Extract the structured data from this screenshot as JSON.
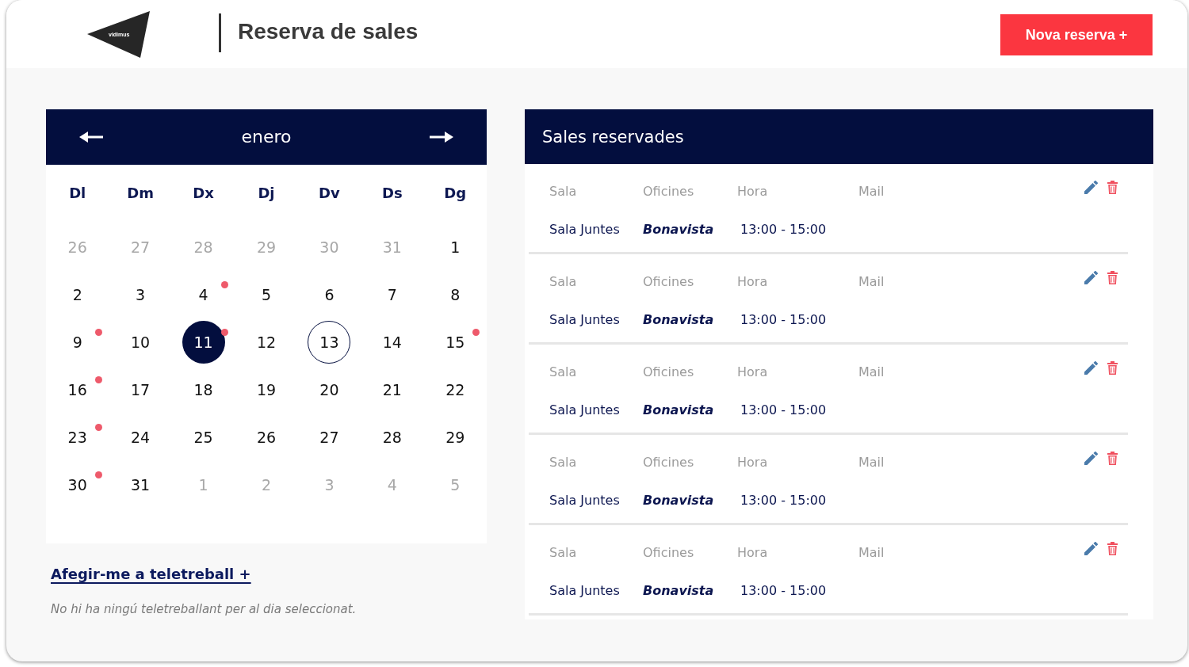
{
  "header": {
    "logo_text": "vidimus",
    "title": "Reserva de sales",
    "new_button": "Nova reserva +"
  },
  "calendar": {
    "month": "enero",
    "weekdays": [
      "Dl",
      "Dm",
      "Dx",
      "Dj",
      "Dv",
      "Ds",
      "Dg"
    ],
    "days": [
      {
        "label": "26",
        "outside_month": true,
        "selected": false,
        "today": false,
        "marked": false
      },
      {
        "label": "27",
        "outside_month": true,
        "selected": false,
        "today": false,
        "marked": false
      },
      {
        "label": "28",
        "outside_month": true,
        "selected": false,
        "today": false,
        "marked": false
      },
      {
        "label": "29",
        "outside_month": true,
        "selected": false,
        "today": false,
        "marked": false
      },
      {
        "label": "30",
        "outside_month": true,
        "selected": false,
        "today": false,
        "marked": false
      },
      {
        "label": "31",
        "outside_month": true,
        "selected": false,
        "today": false,
        "marked": false
      },
      {
        "label": "1",
        "outside_month": false,
        "selected": false,
        "today": false,
        "marked": false
      },
      {
        "label": "2",
        "outside_month": false,
        "selected": false,
        "today": false,
        "marked": false
      },
      {
        "label": "3",
        "outside_month": false,
        "selected": false,
        "today": false,
        "marked": false
      },
      {
        "label": "4",
        "outside_month": false,
        "selected": false,
        "today": false,
        "marked": true
      },
      {
        "label": "5",
        "outside_month": false,
        "selected": false,
        "today": false,
        "marked": false
      },
      {
        "label": "6",
        "outside_month": false,
        "selected": false,
        "today": false,
        "marked": false
      },
      {
        "label": "7",
        "outside_month": false,
        "selected": false,
        "today": false,
        "marked": false
      },
      {
        "label": "8",
        "outside_month": false,
        "selected": false,
        "today": false,
        "marked": false
      },
      {
        "label": "9",
        "outside_month": false,
        "selected": false,
        "today": false,
        "marked": true
      },
      {
        "label": "10",
        "outside_month": false,
        "selected": false,
        "today": false,
        "marked": false
      },
      {
        "label": "11",
        "outside_month": false,
        "selected": true,
        "today": false,
        "marked": true
      },
      {
        "label": "12",
        "outside_month": false,
        "selected": false,
        "today": false,
        "marked": false
      },
      {
        "label": "13",
        "outside_month": false,
        "selected": false,
        "today": true,
        "marked": false
      },
      {
        "label": "14",
        "outside_month": false,
        "selected": false,
        "today": false,
        "marked": false
      },
      {
        "label": "15",
        "outside_month": false,
        "selected": false,
        "today": false,
        "marked": true
      },
      {
        "label": "16",
        "outside_month": false,
        "selected": false,
        "today": false,
        "marked": true
      },
      {
        "label": "17",
        "outside_month": false,
        "selected": false,
        "today": false,
        "marked": false
      },
      {
        "label": "18",
        "outside_month": false,
        "selected": false,
        "today": false,
        "marked": false
      },
      {
        "label": "19",
        "outside_month": false,
        "selected": false,
        "today": false,
        "marked": false
      },
      {
        "label": "20",
        "outside_month": false,
        "selected": false,
        "today": false,
        "marked": false
      },
      {
        "label": "21",
        "outside_month": false,
        "selected": false,
        "today": false,
        "marked": false
      },
      {
        "label": "22",
        "outside_month": false,
        "selected": false,
        "today": false,
        "marked": false
      },
      {
        "label": "23",
        "outside_month": false,
        "selected": false,
        "today": false,
        "marked": true
      },
      {
        "label": "24",
        "outside_month": false,
        "selected": false,
        "today": false,
        "marked": false
      },
      {
        "label": "25",
        "outside_month": false,
        "selected": false,
        "today": false,
        "marked": false
      },
      {
        "label": "26",
        "outside_month": false,
        "selected": false,
        "today": false,
        "marked": false
      },
      {
        "label": "27",
        "outside_month": false,
        "selected": false,
        "today": false,
        "marked": false
      },
      {
        "label": "28",
        "outside_month": false,
        "selected": false,
        "today": false,
        "marked": false
      },
      {
        "label": "29",
        "outside_month": false,
        "selected": false,
        "today": false,
        "marked": false
      },
      {
        "label": "30",
        "outside_month": false,
        "selected": false,
        "today": false,
        "marked": true
      },
      {
        "label": "31",
        "outside_month": false,
        "selected": false,
        "today": false,
        "marked": false
      },
      {
        "label": "1",
        "outside_month": true,
        "selected": false,
        "today": false,
        "marked": false
      },
      {
        "label": "2",
        "outside_month": true,
        "selected": false,
        "today": false,
        "marked": false
      },
      {
        "label": "3",
        "outside_month": true,
        "selected": false,
        "today": false,
        "marked": false
      },
      {
        "label": "4",
        "outside_month": true,
        "selected": false,
        "today": false,
        "marked": false
      },
      {
        "label": "5",
        "outside_month": true,
        "selected": false,
        "today": false,
        "marked": false
      }
    ]
  },
  "telework": {
    "link": "Afegir-me a teletreball +",
    "message": "No hi ha ningú teletreballant per al dia seleccionat."
  },
  "reservations": {
    "title": "Sales reservades",
    "items": [
      {
        "fields": [
          {
            "label": "Sala",
            "value": "Sala Juntes"
          },
          {
            "label": "Oficines",
            "value": "Bonavista"
          },
          {
            "label": "Hora",
            "value": "13:00 - 15:00"
          },
          {
            "label": "Mail"
          }
        ]
      },
      {
        "fields": [
          {
            "label": "Sala",
            "value": "Sala Juntes"
          },
          {
            "label": "Oficines",
            "value": "Bonavista"
          },
          {
            "label": "Hora",
            "value": "13:00 - 15:00"
          },
          {
            "label": "Mail"
          }
        ]
      },
      {
        "fields": [
          {
            "label": "Sala",
            "value": "Sala Juntes"
          },
          {
            "label": "Oficines",
            "value": "Bonavista"
          },
          {
            "label": "Hora",
            "value": "13:00 - 15:00"
          },
          {
            "label": "Mail"
          }
        ]
      },
      {
        "fields": [
          {
            "label": "Sala",
            "value": "Sala Juntes"
          },
          {
            "label": "Oficines",
            "value": "Bonavista"
          },
          {
            "label": "Hora",
            "value": "13:00 - 15:00"
          },
          {
            "label": "Mail"
          }
        ]
      },
      {
        "fields": [
          {
            "label": "Sala",
            "value": "Sala Juntes"
          },
          {
            "label": "Oficines",
            "value": "Bonavista"
          },
          {
            "label": "Hora",
            "value": "13:00 - 15:00"
          },
          {
            "label": "Mail"
          }
        ]
      }
    ]
  }
}
